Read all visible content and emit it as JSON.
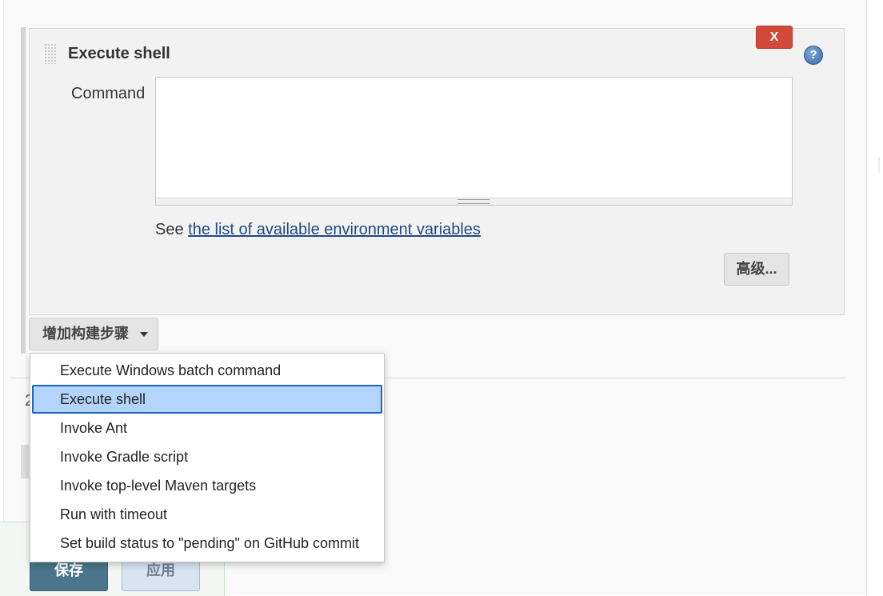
{
  "step": {
    "title": "Execute shell",
    "delete_label": "X",
    "help_label": "?",
    "command_label": "Command",
    "command_value": "",
    "env_prefix": "See ",
    "env_link": "the list of available environment variables",
    "advanced_label": "高级..."
  },
  "add_step": {
    "label": "增加构建步骤"
  },
  "dropdown": {
    "selected": "Execute shell",
    "items": [
      {
        "label": "Execute Windows batch command"
      },
      {
        "label": "Execute shell"
      },
      {
        "label": "Invoke Ant"
      },
      {
        "label": "Invoke Gradle script"
      },
      {
        "label": "Invoke top-level Maven targets"
      },
      {
        "label": "Run with timeout"
      },
      {
        "label": "Set build status to \"pending\" on GitHub commit"
      }
    ]
  },
  "background": {
    "section_label_fragment": "2"
  },
  "footer": {
    "save_label": "保存",
    "apply_label": "应用"
  },
  "colors": {
    "delete": "#d24939",
    "link": "#204a87",
    "selected_item_bg": "#b3d4fc",
    "selected_item_border": "#1a64c8",
    "save_bg": "#4b758b",
    "apply_bg": "#d8e4f2"
  },
  "icons": {
    "drag_handle": "drag-handle-icon",
    "help": "help-icon",
    "caret": "caret-down-icon"
  }
}
